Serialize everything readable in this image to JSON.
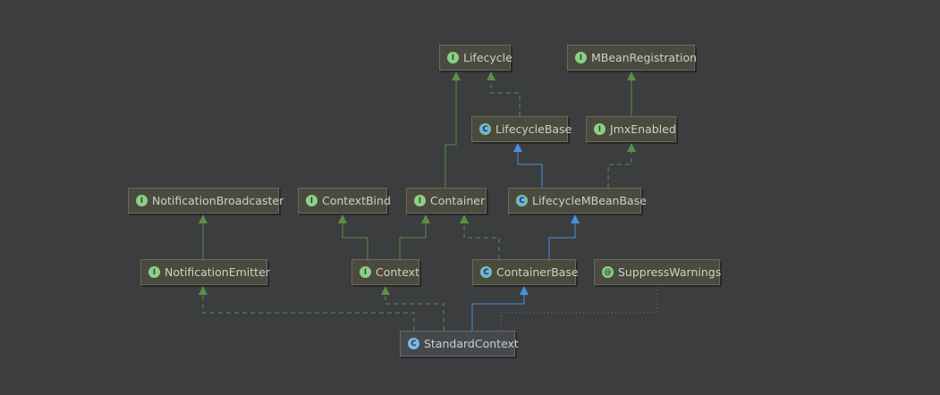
{
  "diagram": {
    "background": "#3b3d3f",
    "colors": {
      "implements": "#5c8f45",
      "extends": "#4a8fe0",
      "annotation_dotted": "#7a7a52"
    },
    "nodes": [
      {
        "id": "lifecycle",
        "label": "Lifecycle",
        "kind": "interface",
        "badge": "I",
        "icon": "interface-icon"
      },
      {
        "id": "mbeanregistration",
        "label": "MBeanRegistration",
        "kind": "interface",
        "badge": "I",
        "icon": "interface-icon"
      },
      {
        "id": "lifecyclebase",
        "label": "LifecycleBase",
        "kind": "abstract-class",
        "badge": "C",
        "icon": "abstract-class-icon"
      },
      {
        "id": "jmxenabled",
        "label": "JmxEnabled",
        "kind": "interface",
        "badge": "I",
        "icon": "interface-icon"
      },
      {
        "id": "notificationbroadcaster",
        "label": "NotificationBroadcaster",
        "kind": "interface",
        "badge": "I",
        "icon": "interface-icon"
      },
      {
        "id": "contextbind",
        "label": "ContextBind",
        "kind": "interface",
        "badge": "I",
        "icon": "interface-icon"
      },
      {
        "id": "container",
        "label": "Container",
        "kind": "interface",
        "badge": "I",
        "icon": "interface-icon"
      },
      {
        "id": "lifecyclembeanbase",
        "label": "LifecycleMBeanBase",
        "kind": "abstract-class",
        "badge": "C",
        "icon": "abstract-class-icon"
      },
      {
        "id": "notificationemitter",
        "label": "NotificationEmitter",
        "kind": "interface",
        "badge": "I",
        "icon": "interface-icon"
      },
      {
        "id": "context",
        "label": "Context",
        "kind": "interface",
        "badge": "I",
        "icon": "interface-icon"
      },
      {
        "id": "containerbase",
        "label": "ContainerBase",
        "kind": "abstract-class",
        "badge": "C",
        "icon": "abstract-class-icon"
      },
      {
        "id": "suppresswarnings",
        "label": "SuppressWarnings",
        "kind": "annotation",
        "badge": "@",
        "icon": "annotation-icon"
      },
      {
        "id": "standardcontext",
        "label": "StandardContext",
        "kind": "class",
        "badge": "C",
        "icon": "class-icon"
      }
    ],
    "edges": [
      {
        "from": "container",
        "to": "lifecycle",
        "type": "extends-interface"
      },
      {
        "from": "lifecyclebase",
        "to": "lifecycle",
        "type": "implements"
      },
      {
        "from": "jmxenabled",
        "to": "mbeanregistration",
        "type": "extends-interface"
      },
      {
        "from": "lifecyclembeanbase",
        "to": "lifecyclebase",
        "type": "extends"
      },
      {
        "from": "lifecyclembeanbase",
        "to": "jmxenabled",
        "type": "implements"
      },
      {
        "from": "notificationemitter",
        "to": "notificationbroadcaster",
        "type": "extends-interface"
      },
      {
        "from": "context",
        "to": "contextbind",
        "type": "extends-interface"
      },
      {
        "from": "context",
        "to": "container",
        "type": "extends-interface"
      },
      {
        "from": "containerbase",
        "to": "container",
        "type": "implements"
      },
      {
        "from": "containerbase",
        "to": "lifecyclembeanbase",
        "type": "extends"
      },
      {
        "from": "standardcontext",
        "to": "notificationemitter",
        "type": "implements"
      },
      {
        "from": "standardcontext",
        "to": "context",
        "type": "implements"
      },
      {
        "from": "standardcontext",
        "to": "containerbase",
        "type": "extends"
      },
      {
        "from": "standardcontext",
        "to": "suppresswarnings",
        "type": "annotated"
      }
    ]
  }
}
